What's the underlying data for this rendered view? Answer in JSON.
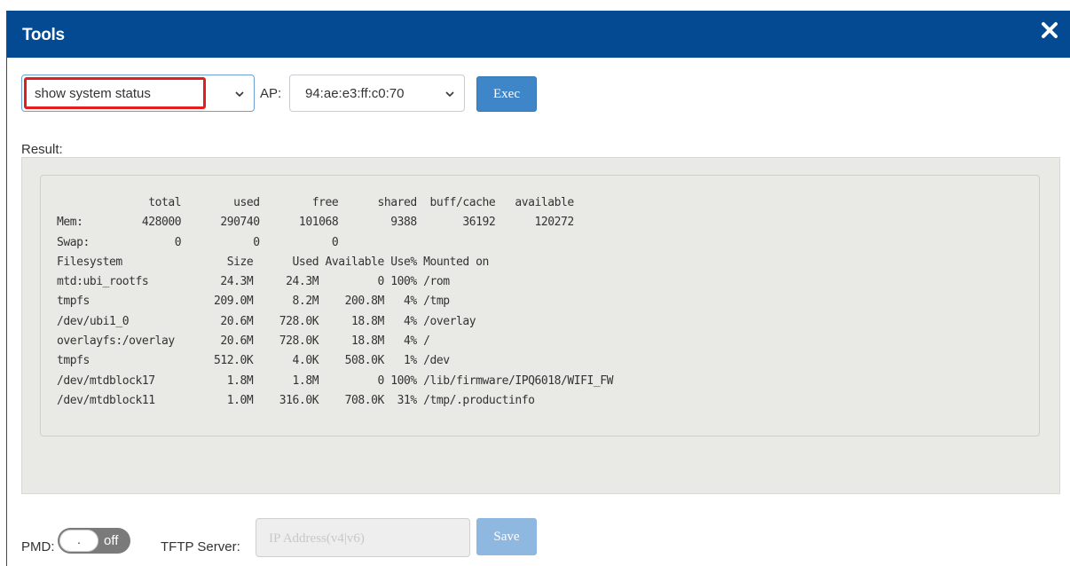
{
  "window": {
    "title": "Tools"
  },
  "toolbar": {
    "command_value": "show system status",
    "ap_label": "AP:",
    "ap_value": "94:ae:e3:ff:c0:70",
    "exec_label": "Exec"
  },
  "result": {
    "label": "Result:",
    "lines": [
      "              total        used        free      shared  buff/cache   available",
      "Mem:         428000      290740      101068        9388       36192      120272",
      "Swap:             0           0           0",
      "Filesystem                Size      Used Available Use% Mounted on",
      "mtd:ubi_rootfs           24.3M     24.3M         0 100% /rom",
      "tmpfs                   209.0M      8.2M    200.8M   4% /tmp",
      "/dev/ubi1_0              20.6M    728.0K     18.8M   4% /overlay",
      "overlayfs:/overlay       20.6M    728.0K     18.8M   4% /",
      "tmpfs                   512.0K      4.0K    508.0K   1% /dev",
      "/dev/mtdblock17           1.8M      1.8M         0 100% /lib/firmware/IPQ6018/WIFI_FW",
      "/dev/mtdblock11           1.0M    316.0K    708.0K  31% /tmp/.productinfo"
    ]
  },
  "footer": {
    "pmd_label": "PMD:",
    "pmd_knob": ".",
    "pmd_state": "off",
    "tftp_label": "TFTP Server:",
    "tftp_placeholder": "IP Address(v4|v6)",
    "save_label": "Save"
  },
  "colors": {
    "titlebar": "#034a92",
    "button": "#3f86c8",
    "highlight": "#e02020"
  },
  "icons": {
    "close": "close-icon",
    "dropdown": "chevron-down-icon"
  }
}
